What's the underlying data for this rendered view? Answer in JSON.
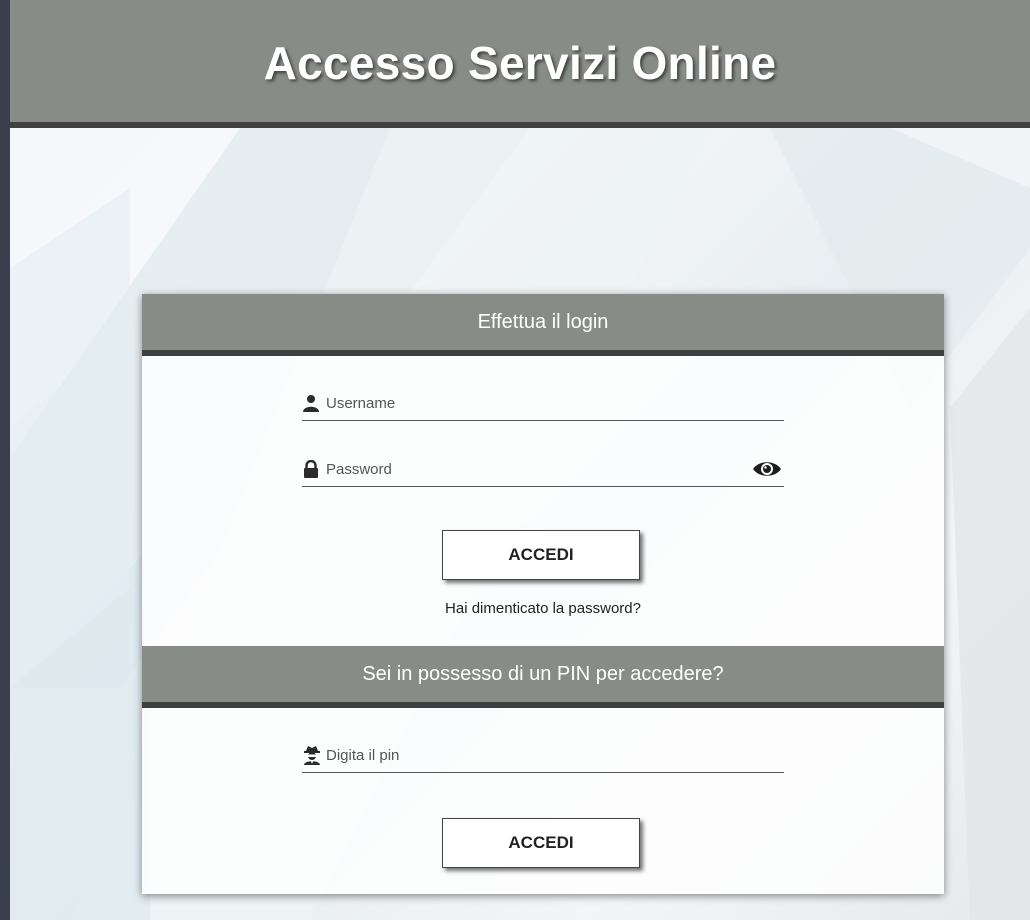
{
  "header": {
    "title": "Accesso Servizi Online"
  },
  "login": {
    "heading": "Effettua il login",
    "username_placeholder": "Username",
    "password_placeholder": "Password",
    "submit_label": "ACCEDI",
    "forgot_label": "Hai dimenticato la password?"
  },
  "pin": {
    "heading": "Sei in possesso di un PIN per accedere?",
    "pin_placeholder": "Digita il pin",
    "submit_label": "ACCEDI"
  },
  "icons": {
    "username": "user-icon",
    "password": "lock-icon",
    "toggle_password": "eye-icon",
    "pin": "user-secret-icon"
  },
  "colors": {
    "header_bg": "#878c87",
    "header_border": "#404040",
    "page_bg": "#3a3f4e"
  }
}
